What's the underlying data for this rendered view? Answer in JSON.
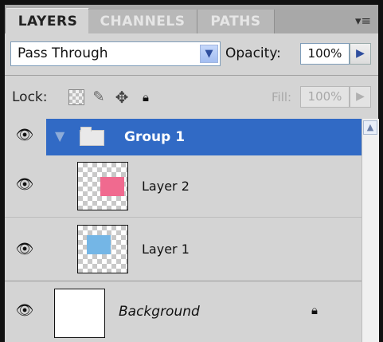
{
  "tabs": [
    {
      "label": "LAYERS",
      "active": true
    },
    {
      "label": "CHANNELS",
      "active": false
    },
    {
      "label": "PATHS",
      "active": false
    }
  ],
  "panel_menu_icon": "panel-menu-icon",
  "blend": {
    "mode": "Pass Through",
    "opacity_label": "Opacity:",
    "opacity_value": "100%"
  },
  "lock": {
    "label": "Lock:",
    "fill_label": "Fill:",
    "fill_value": "100%"
  },
  "layers": {
    "group": {
      "name": "Group 1"
    },
    "layer2": {
      "name": "Layer 2",
      "swatch_color": "#f06a8f"
    },
    "layer1": {
      "name": "Layer 1",
      "swatch_color": "#74b6e6"
    },
    "background": {
      "name": "Background"
    }
  },
  "colors": {
    "selection": "#316ac5",
    "panel_bg": "#d4d4d4"
  }
}
